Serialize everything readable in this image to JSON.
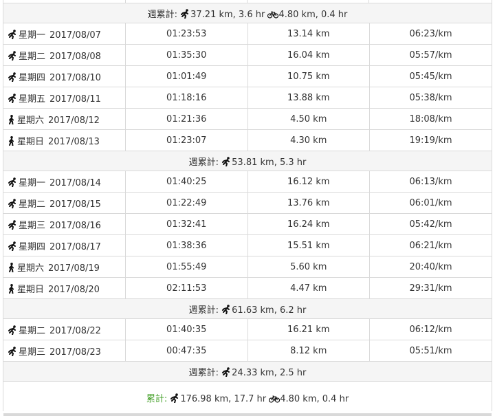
{
  "top_week": {
    "label": "週累計:",
    "run": "37.21 km, 3.6 hr",
    "bike": "4.80 km, 0.4 hr"
  },
  "weeks": [
    {
      "days": [
        {
          "type": "run",
          "day": "星期一",
          "date": "2017/08/07",
          "time": "01:23:53",
          "dist": "13.14 km",
          "pace": "06:23/km"
        },
        {
          "type": "run",
          "day": "星期二",
          "date": "2017/08/08",
          "time": "01:35:30",
          "dist": "16.04 km",
          "pace": "05:57/km"
        },
        {
          "type": "run",
          "day": "星期四",
          "date": "2017/08/10",
          "time": "01:01:49",
          "dist": "10.75 km",
          "pace": "05:45/km"
        },
        {
          "type": "run",
          "day": "星期五",
          "date": "2017/08/11",
          "time": "01:18:16",
          "dist": "13.88 km",
          "pace": "05:38/km"
        },
        {
          "type": "walk",
          "day": "星期六",
          "date": "2017/08/12",
          "time": "01:21:36",
          "dist": "4.50 km",
          "pace": "18:08/km"
        },
        {
          "type": "walk",
          "day": "星期日",
          "date": "2017/08/13",
          "time": "01:23:07",
          "dist": "4.30 km",
          "pace": "19:19/km"
        }
      ],
      "summary": {
        "label": "週累計:",
        "run": "53.81 km, 5.3 hr"
      }
    },
    {
      "days": [
        {
          "type": "run",
          "day": "星期一",
          "date": "2017/08/14",
          "time": "01:40:25",
          "dist": "16.12 km",
          "pace": "06:13/km"
        },
        {
          "type": "run",
          "day": "星期二",
          "date": "2017/08/15",
          "time": "01:22:49",
          "dist": "13.76 km",
          "pace": "06:01/km"
        },
        {
          "type": "run",
          "day": "星期三",
          "date": "2017/08/16",
          "time": "01:32:41",
          "dist": "16.24 km",
          "pace": "05:42/km"
        },
        {
          "type": "run",
          "day": "星期四",
          "date": "2017/08/17",
          "time": "01:38:36",
          "dist": "15.51 km",
          "pace": "06:21/km"
        },
        {
          "type": "walk",
          "day": "星期六",
          "date": "2017/08/19",
          "time": "01:55:49",
          "dist": "5.60 km",
          "pace": "20:40/km"
        },
        {
          "type": "walk",
          "day": "星期日",
          "date": "2017/08/20",
          "time": "02:11:53",
          "dist": "4.47 km",
          "pace": "29:31/km"
        }
      ],
      "summary": {
        "label": "週累計:",
        "run": "61.63 km, 6.2 hr"
      }
    },
    {
      "days": [
        {
          "type": "run",
          "day": "星期二",
          "date": "2017/08/22",
          "time": "01:40:35",
          "dist": "16.21 km",
          "pace": "06:12/km"
        },
        {
          "type": "run",
          "day": "星期三",
          "date": "2017/08/23",
          "time": "00:47:35",
          "dist": "8.12 km",
          "pace": "05:51/km"
        }
      ],
      "summary": {
        "label": "週累計:",
        "run": "24.33 km, 2.5 hr"
      }
    }
  ],
  "grand_total": {
    "label": "累計:",
    "run": "176.98 km, 17.7 hr",
    "bike": "4.80 km, 0.4 hr"
  },
  "icons": {
    "run": "running-icon",
    "walk": "walking-icon",
    "bike": "bicycle-icon"
  },
  "colors": {
    "total_label": "#46a12b",
    "summary_bg": "#f5f5f5",
    "border": "#d9d9d9"
  }
}
